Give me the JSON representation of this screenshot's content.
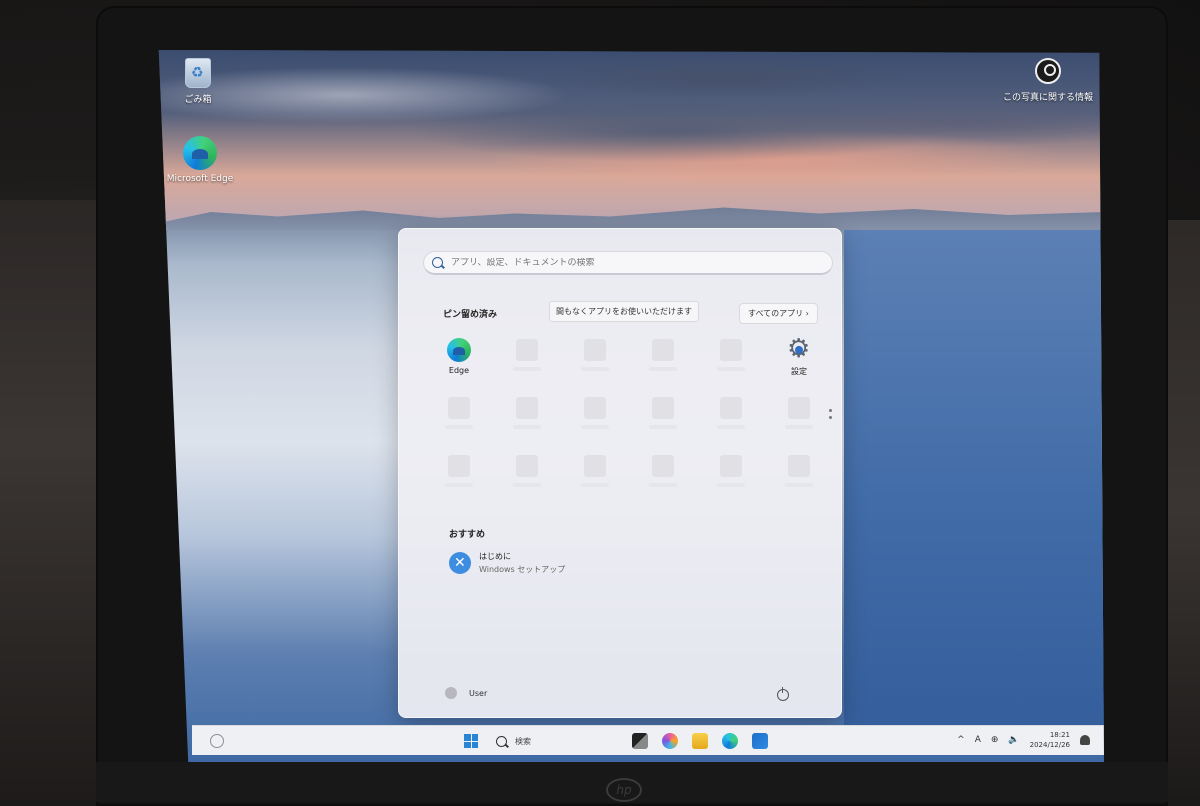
{
  "desktop": {
    "recycle_bin_label": "ごみ箱",
    "edge_label": "Microsoft Edge",
    "photo_info_label": "この写真に関する情報"
  },
  "start_menu": {
    "search_placeholder": "アプリ、設定、ドキュメントの検索",
    "pinned_title": "ピン留め済み",
    "loading_tooltip": "間もなくアプリをお使いいただけます",
    "all_apps_label": "すべてのアプリ",
    "pinned_apps": [
      {
        "label": "Edge",
        "icon": "edge-icon"
      },
      {
        "label": "",
        "icon": "placeholder"
      },
      {
        "label": "",
        "icon": "placeholder"
      },
      {
        "label": "",
        "icon": "placeholder"
      },
      {
        "label": "",
        "icon": "placeholder"
      },
      {
        "label": "設定",
        "icon": "gear-icon"
      }
    ],
    "recommended_title": "おすすめ",
    "recommended": [
      {
        "name": "はじめに",
        "sub": "Windows セットアップ"
      }
    ],
    "user_name": "User"
  },
  "taskbar": {
    "search_label": "検索",
    "ime_label": "A",
    "time": "18:21",
    "date": "2024/12/26"
  },
  "colors": {
    "accent": "#2a84d6",
    "menu_bg": "#eeeef3"
  }
}
